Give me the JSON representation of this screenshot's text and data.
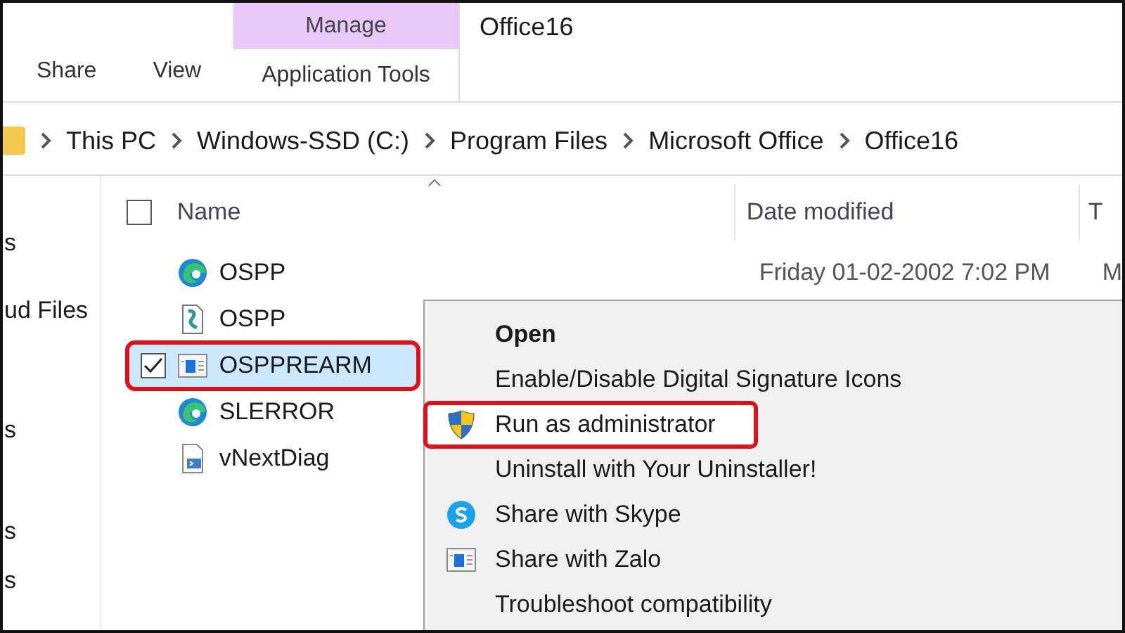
{
  "ribbon": {
    "tabs": [
      {
        "label": "Share",
        "selected": false
      },
      {
        "label": "View",
        "selected": false
      }
    ],
    "contextual": {
      "group": "Manage",
      "tab": "Application Tools"
    },
    "title": "Office16"
  },
  "breadcrumbs": [
    "This PC",
    "Windows-SSD (C:)",
    "Program Files",
    "Microsoft Office",
    "Office16"
  ],
  "sidebar": {
    "items": [
      "s",
      "ud Files",
      "s",
      "s",
      "s"
    ]
  },
  "table": {
    "select_all": {
      "checked": false
    },
    "columns": [
      "Name",
      "Date modified",
      "T"
    ],
    "rows": [
      {
        "name": "OSPP",
        "kind": "edge",
        "date": "Friday 01-02-2002 7:02 PM",
        "column_3": "M",
        "selected": false,
        "checked": false,
        "highlighted": false
      },
      {
        "name": "OSPP",
        "kind": "script",
        "selected": false,
        "checked": false,
        "highlighted": false
      },
      {
        "name": "OSPPREARM",
        "kind": "app",
        "selected": true,
        "checked": true,
        "highlighted": true
      },
      {
        "name": "SLERROR",
        "kind": "edge",
        "selected": false,
        "checked": false,
        "highlighted": false
      },
      {
        "name": "vNextDiag",
        "kind": "shell",
        "selected": false,
        "checked": false,
        "highlighted": false
      }
    ]
  },
  "context_menu": {
    "items": [
      {
        "label": "Open",
        "kind": "plain",
        "bold": true,
        "hover": false,
        "highlighted": false
      },
      {
        "label": "Enable/Disable Digital Signature Icons",
        "kind": "plain",
        "bold": false,
        "hover": false,
        "highlighted": false
      },
      {
        "label": "Run as administrator",
        "kind": "shield",
        "bold": false,
        "hover": true,
        "highlighted": true
      },
      {
        "label": "Uninstall with Your Uninstaller!",
        "kind": "plain",
        "bold": false,
        "hover": false,
        "highlighted": false
      },
      {
        "label": "Share with Skype",
        "kind": "skype",
        "bold": false,
        "hover": false,
        "highlighted": false
      },
      {
        "label": "Share with Zalo",
        "kind": "app",
        "bold": false,
        "hover": false,
        "highlighted": false
      },
      {
        "label": "Troubleshoot compatibility",
        "kind": "plain",
        "bold": false,
        "hover": false,
        "highlighted": false
      }
    ]
  }
}
